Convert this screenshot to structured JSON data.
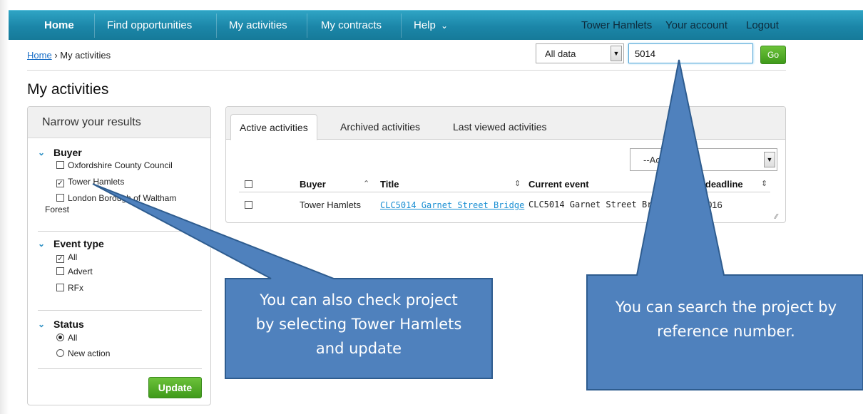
{
  "nav": {
    "home": "Home",
    "find": "Find opportunities",
    "activities": "My activities",
    "contracts": "My contracts",
    "help": "Help",
    "help_chevron": "⌄",
    "user": "Tower Hamlets",
    "account": "Your account",
    "logout": "Logout"
  },
  "breadcrumb": {
    "home": "Home",
    "separator": "›",
    "current": "My activities"
  },
  "search": {
    "scope": "All data",
    "query": "5014",
    "go": "Go"
  },
  "page_title": "My activities",
  "sidebar": {
    "header": "Narrow your results",
    "buyer": {
      "title": "Buyer",
      "options": [
        {
          "label": "Oxfordshire County Council",
          "checked": false
        },
        {
          "label": "Tower Hamlets",
          "checked": true
        },
        {
          "label": "London Borough of Waltham",
          "label2": "Forest",
          "checked": false
        }
      ]
    },
    "event_type": {
      "title": "Event type",
      "options": [
        {
          "label": "All",
          "checked": true
        },
        {
          "label": "Advert",
          "checked": false
        },
        {
          "label": "RFx",
          "checked": false
        }
      ]
    },
    "status": {
      "title": "Status",
      "options": [
        {
          "label": "All",
          "selected": true
        },
        {
          "label": "New action",
          "selected": false
        }
      ]
    },
    "update": "Update"
  },
  "tabs": [
    "Active activities",
    "Archived activities",
    "Last viewed activities"
  ],
  "actions_placeholder": "--Ac",
  "table": {
    "headers": [
      "Buyer",
      "Title",
      "Current event",
      "nt deadline"
    ],
    "rows": [
      {
        "buyer": "Tower Hamlets",
        "title": "CLC5014 Garnet Street Bridge",
        "event": "CLC5014 Garnet Street Brid",
        "deadline": "8/2016"
      }
    ]
  },
  "callouts": {
    "left": [
      "You can also check project",
      "by selecting Tower Hamlets",
      "and update"
    ],
    "right": [
      "You can search the project by",
      "reference number."
    ]
  },
  "colors": {
    "nav": "#1b86a8",
    "accent_green": "#4fa824",
    "link": "#1a6fc7",
    "callout": "#4f81bd"
  }
}
